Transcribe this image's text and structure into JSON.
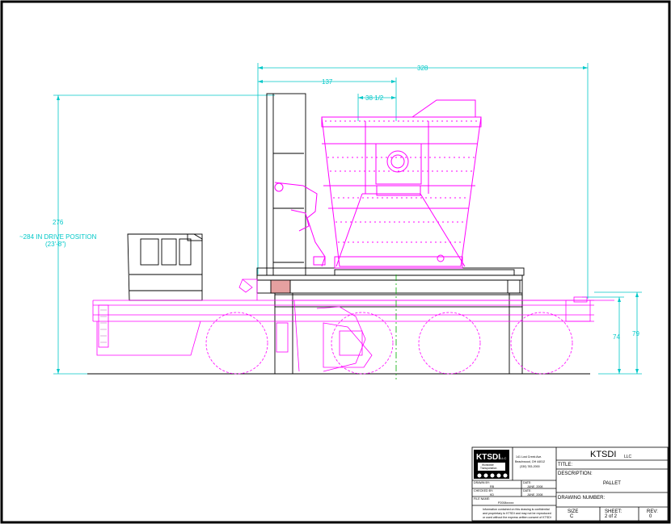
{
  "drawing": {
    "dimensions": {
      "overall_length": "328",
      "front_to_center": "137",
      "center_offset": "38 1/2",
      "overall_height": "276",
      "drive_position_line1": "~284 IN DRIVE POSITION",
      "drive_position_line2": "(23'-8\")",
      "deck_height_a": "74",
      "deck_height_b": "79"
    },
    "colors": {
      "border": "#000000",
      "dimension": "#00c8c8",
      "equipment": "#ff00ff",
      "vehicle": "#000000",
      "centerline": "#00aa00"
    }
  },
  "title_block": {
    "logo_text": "KTSDI",
    "logo_suffix": "LLC",
    "logo_tagline_1": "Worldwide",
    "logo_tagline_2": "Transportation",
    "address_line1": "141 Lost Creek Ave.",
    "address_line2": "Beachwood, OH 44012",
    "address_line3": "(330) 783-2000",
    "company_name": "KTSDI",
    "company_suffix": "LLC",
    "title_label": "TITLE:",
    "description_label": "DESCRIPTION:",
    "description_value": "PALLET",
    "drawing_number_label": "DRAWING NUMBER:",
    "drawn_by_label": "DRAWN BY:",
    "drawn_by_value": "RB",
    "date_label_1": "DATE:",
    "date_value_1": "JUNE_2008",
    "checked_by_label": "CHECKED BY:",
    "checked_by_value": "KD",
    "date_label_2": "DATE:",
    "date_value_2": "JUNE_2008",
    "file_name_label": "FILE NAME:",
    "file_name_value": "P2008xxxxx",
    "disclaimer_1": "Information contained on this drawing is confidential",
    "disclaimer_2": "and proprietary to KTSDI and may not be reproduced",
    "disclaimer_3": "or used without the express written consent of KTSDI",
    "size_label": "SIZE",
    "size_value": "C",
    "sheet_label": "SHEET:",
    "sheet_value": "2 of 2",
    "rev_label": "REV:",
    "rev_value": "0"
  }
}
